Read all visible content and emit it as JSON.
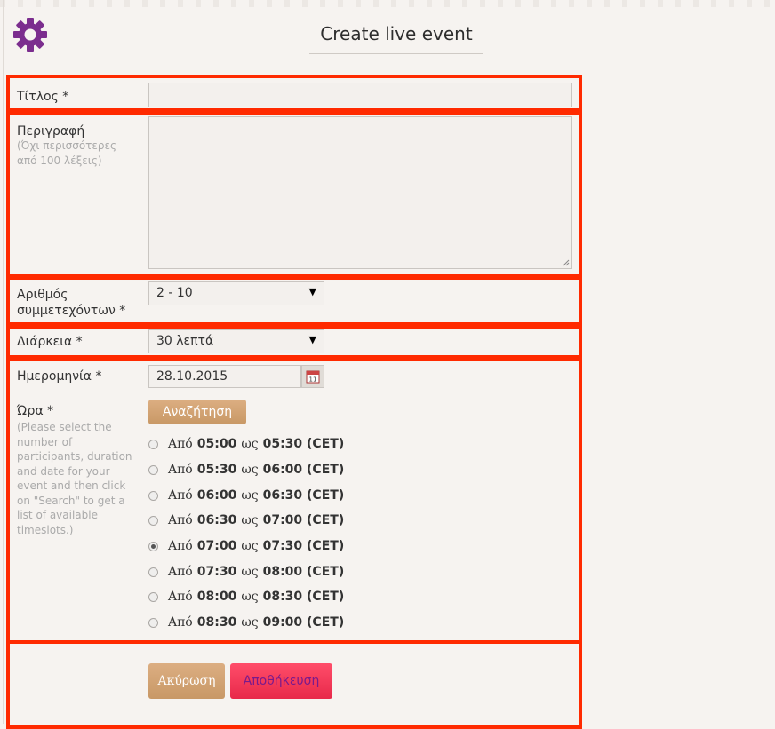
{
  "header": {
    "title": "Create live event",
    "logo": "gear-icon"
  },
  "form": {
    "title_label": "Τίτλος *",
    "title_value": "",
    "description_label": "Περιγραφή",
    "description_hint": "(Όχι περισσότερες από 100 λέξεις)",
    "description_value": "",
    "participants_label": "Αριθμός συμμετεχόντων *",
    "participants_value": "2 - 10",
    "duration_label": "Διάρκεια *",
    "duration_value": "30 λεπτά",
    "date_label": "Ημερομηνία *",
    "date_value": "28.10.2015",
    "time_label": "Ώρα *",
    "time_hint": "(Please select the number of participants, duration and date for your event and then click on \"Search\" to get a list of available timeslots.)",
    "search_button": "Αναζήτηση",
    "slot_from": "Από",
    "slot_to": "ως",
    "slots": [
      {
        "start": "05:00",
        "end": "05:30 (CET)",
        "selected": false
      },
      {
        "start": "05:30",
        "end": "06:00 (CET)",
        "selected": false
      },
      {
        "start": "06:00",
        "end": "06:30 (CET)",
        "selected": false
      },
      {
        "start": "06:30",
        "end": "07:00 (CET)",
        "selected": false
      },
      {
        "start": "07:00",
        "end": "07:30 (CET)",
        "selected": true
      },
      {
        "start": "07:30",
        "end": "08:00 (CET)",
        "selected": false
      },
      {
        "start": "08:00",
        "end": "08:30 (CET)",
        "selected": false
      },
      {
        "start": "08:30",
        "end": "09:00 (CET)",
        "selected": false
      }
    ],
    "cancel_button": "Ακύρωση",
    "save_button": "Αποθήκευση"
  },
  "colors": {
    "accent": "#7b2d8e",
    "highlight_border": "#ff2a00",
    "save": "#e8294a",
    "search": "#c89866"
  }
}
